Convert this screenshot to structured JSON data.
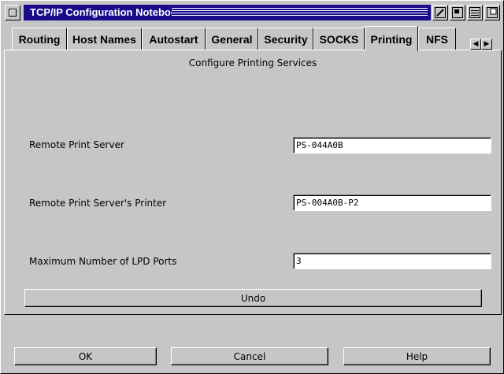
{
  "window": {
    "title": "TCP/IP Configuration Notebook"
  },
  "tabs": [
    {
      "label": "Routing",
      "active": false
    },
    {
      "label": "Host Names",
      "active": false
    },
    {
      "label": "Autostart",
      "active": false
    },
    {
      "label": "General",
      "active": false
    },
    {
      "label": "Security",
      "active": false
    },
    {
      "label": "SOCKS",
      "active": false
    },
    {
      "label": "Printing",
      "active": true
    },
    {
      "label": "NFS",
      "active": false
    }
  ],
  "page": {
    "title": "Configure Printing Services",
    "fields": {
      "remote_print_server": {
        "label": "Remote Print Server",
        "value": "PS-044A0B"
      },
      "remote_printer": {
        "label": "Remote Print Server's Printer",
        "value": "PS-004A0B-P2"
      },
      "max_lpd_ports": {
        "label": "Maximum Number of LPD Ports",
        "value": "3"
      }
    },
    "undo_label": "Undo"
  },
  "buttons": {
    "ok": "OK",
    "cancel": "Cancel",
    "help": "Help"
  },
  "colors": {
    "titlebar": "#1a0a8c",
    "face": "#c6c6c6"
  }
}
